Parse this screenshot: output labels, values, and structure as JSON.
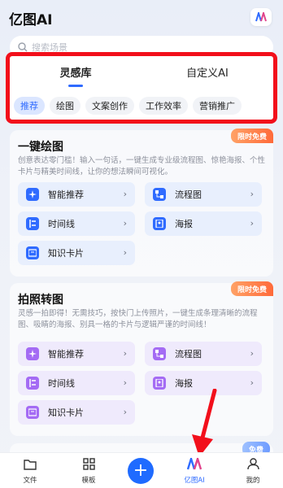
{
  "app": {
    "title": "亿图AI"
  },
  "search": {
    "placeholder": "搜索场景"
  },
  "library": {
    "tabs": [
      {
        "label": "灵感库",
        "active": true
      },
      {
        "label": "自定义AI",
        "active": false
      }
    ],
    "categories": [
      {
        "label": "推荐",
        "active": true
      },
      {
        "label": "绘图",
        "active": false
      },
      {
        "label": "文案创作",
        "active": false
      },
      {
        "label": "工作效率",
        "active": false
      },
      {
        "label": "营销推广",
        "active": false
      }
    ]
  },
  "sections": [
    {
      "title": "一键绘图",
      "badge": "限时免费",
      "desc": "创意表达零门槛！输入一句话，一键生成专业级流程图、惊艳海报、个性卡片与精美时间线，让你的想法瞬间可视化。",
      "tools": [
        {
          "label": "智能推荐",
          "icon": "sparkle-icon"
        },
        {
          "label": "流程图",
          "icon": "flowchart-icon"
        },
        {
          "label": "时间线",
          "icon": "timeline-icon"
        },
        {
          "label": "海报",
          "icon": "poster-icon"
        },
        {
          "label": "知识卡片",
          "icon": "card-icon"
        }
      ]
    },
    {
      "title": "拍照转图",
      "badge": "限时免费",
      "desc": "灵感一拍即得！无需技巧，按快门上传照片，一键生成条理清晰的流程图、吸睛的海报、别具一格的卡片与逻辑严谨的时间线！",
      "tools": [
        {
          "label": "智能推荐",
          "icon": "sparkle-icon"
        },
        {
          "label": "流程图",
          "icon": "flowchart-icon"
        },
        {
          "label": "时间线",
          "icon": "timeline-icon"
        },
        {
          "label": "海报",
          "icon": "poster-icon"
        },
        {
          "label": "知识卡片",
          "icon": "card-icon"
        }
      ]
    },
    {
      "title": "",
      "badge": "免费"
    }
  ],
  "nav": [
    {
      "label": "文件",
      "icon": "folder-icon",
      "active": false
    },
    {
      "label": "模板",
      "icon": "template-grid-icon",
      "active": false
    },
    {
      "label": "",
      "icon": "plus-icon",
      "active": false
    },
    {
      "label": "亿图AI",
      "icon": "ai-logo-icon",
      "active": true
    },
    {
      "label": "我的",
      "icon": "user-icon",
      "active": false
    }
  ],
  "colors": {
    "accent": "#2f6bff",
    "highlight_box": "#f20f1b",
    "badge": "#ff7a45",
    "purple_icon": "#a46bf4"
  }
}
